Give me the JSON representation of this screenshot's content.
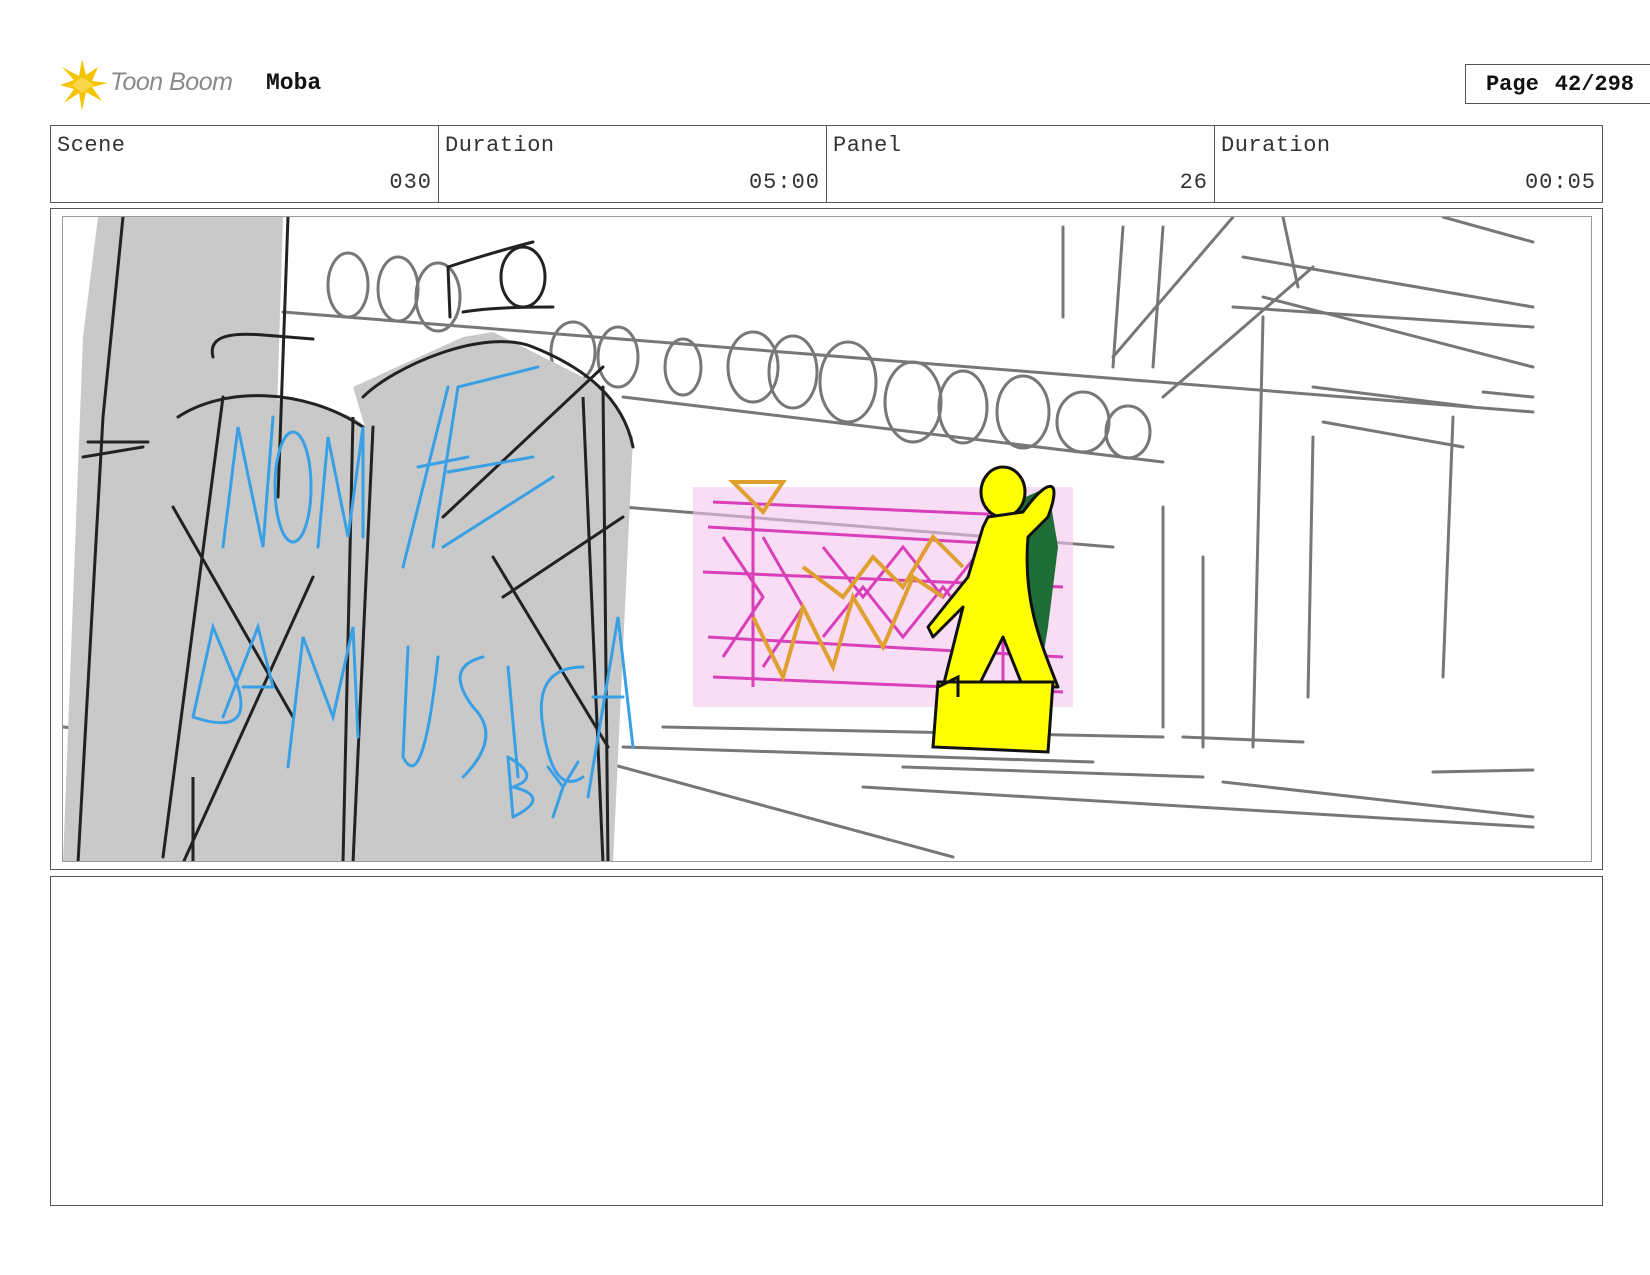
{
  "header": {
    "logo_text": "Toon Boom",
    "project_name": "Moba",
    "page_label": "Page",
    "page_value": "42/298"
  },
  "info": {
    "scene_label": "Scene",
    "scene_value": "030",
    "scene_duration_label": "Duration",
    "scene_duration_value": "05:00",
    "panel_label": "Panel",
    "panel_value": "26",
    "panel_duration_label": "Duration",
    "panel_duration_value": "00:05"
  },
  "drawing": {
    "graffiti_text": [
      "NON ME",
      "DA MUSICA",
      "BY"
    ]
  },
  "notes": {
    "text": ""
  }
}
